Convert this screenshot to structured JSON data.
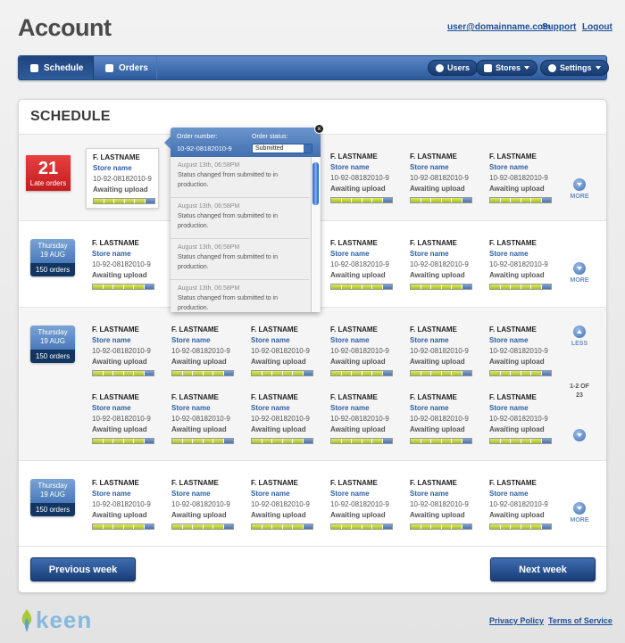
{
  "header": {
    "title": "Account",
    "user_link": "user@domainname.com",
    "support_link": "Support",
    "logout_link": "Logout"
  },
  "nav": {
    "schedule": "Schedule",
    "orders": "Orders",
    "users": "Users",
    "stores": "Stores",
    "settings": "Settings"
  },
  "schedule": {
    "title": "SCHEDULE",
    "late": {
      "count": "21",
      "label": "Late orders"
    },
    "rows": [
      {
        "day": "Thursday",
        "date": "19 AUG",
        "orders": "150 orders"
      },
      {
        "day": "Thursday",
        "date": "19 AUG",
        "orders": "150 orders"
      },
      {
        "day": "Thursday",
        "date": "19 AUG",
        "orders": "150 orders"
      }
    ],
    "card": {
      "name": "F. LASTNAME",
      "store": "Store name",
      "number": "10-92-08182010-9",
      "status": "Awaiting upload",
      "progress_filled": 5,
      "progress_total": 6
    },
    "more_label": "MORE",
    "less_label": "LESS",
    "page_info": "1-2 OF 23"
  },
  "popup": {
    "order_number_label": "Order number:",
    "order_number": "10-92-08182010-9",
    "order_status_label": "Order status:",
    "order_status": "Submitted",
    "entries": [
      {
        "date": "August 13th, 06:58PM",
        "text": "Status changed from submitted to in production."
      },
      {
        "date": "August 13th, 06:58PM",
        "text": "Status changed from submitted to in production."
      },
      {
        "date": "August 13th, 06:58PM",
        "text": "Status changed from submitted to in production."
      },
      {
        "date": "August 13th, 06:58PM",
        "text": "Status changed from submitted to in production."
      }
    ]
  },
  "buttons": {
    "previous": "Previous week",
    "next": "Next week"
  },
  "footer": {
    "logo": "keen",
    "privacy": "Privacy Policy",
    "terms": "Terms of Service"
  }
}
